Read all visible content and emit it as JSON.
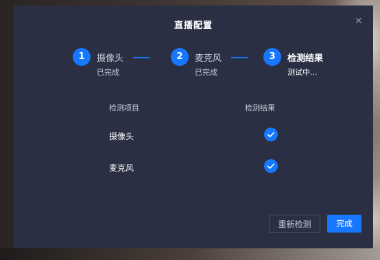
{
  "dialog": {
    "title": "直播配置",
    "close_icon": "close-icon"
  },
  "steps": [
    {
      "number": "1",
      "name": "摄像头",
      "status": "已完成",
      "active": false
    },
    {
      "number": "2",
      "name": "麦克风",
      "status": "已完成",
      "active": false
    },
    {
      "number": "3",
      "name": "检测结果",
      "status": "测试中...",
      "active": true
    }
  ],
  "results": {
    "col_item": "检测项目",
    "col_result": "检测结果",
    "rows": [
      {
        "item": "摄像头",
        "passed": true,
        "icon": "check-circle-icon"
      },
      {
        "item": "麦克风",
        "passed": true,
        "icon": "check-circle-icon"
      }
    ]
  },
  "footer": {
    "retest_label": "重新检测",
    "done_label": "完成"
  },
  "colors": {
    "accent": "#1677ff",
    "dialog_bg": "#2b2f43"
  }
}
